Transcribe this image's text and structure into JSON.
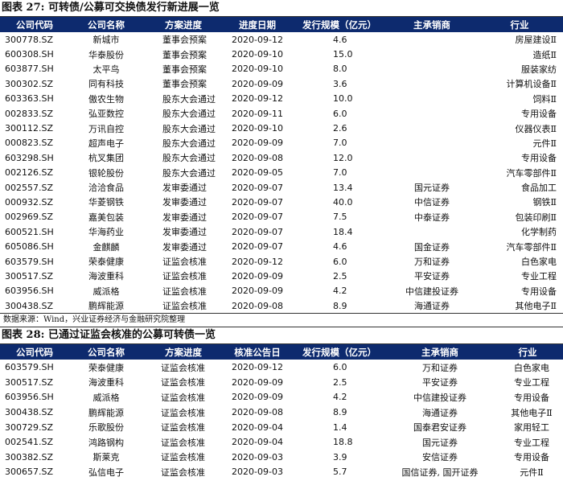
{
  "table1": {
    "title": "图表 27:  可转债/公募可交换债发行新进展一览",
    "headers": [
      "公司代码",
      "公司名称",
      "方案进度",
      "进度日期",
      "发行规模（亿元）",
      "主承销商",
      "行业"
    ],
    "rows": [
      [
        "300778.SZ",
        "新城市",
        "董事会预案",
        "2020-09-12",
        "4.6",
        "",
        "房屋建设Ⅱ"
      ],
      [
        "600308.SH",
        "华泰股份",
        "董事会预案",
        "2020-09-10",
        "15.0",
        "",
        "造纸Ⅱ"
      ],
      [
        "603877.SH",
        "太平鸟",
        "董事会预案",
        "2020-09-10",
        "8.0",
        "",
        "服装家纺"
      ],
      [
        "300302.SZ",
        "同有科技",
        "董事会预案",
        "2020-09-09",
        "3.6",
        "",
        "计算机设备Ⅱ"
      ],
      [
        "603363.SH",
        "傲农生物",
        "股东大会通过",
        "2020-09-12",
        "10.0",
        "",
        "饲料Ⅱ"
      ],
      [
        "002833.SZ",
        "弘亚数控",
        "股东大会通过",
        "2020-09-11",
        "6.0",
        "",
        "专用设备"
      ],
      [
        "300112.SZ",
        "万讯自控",
        "股东大会通过",
        "2020-09-10",
        "2.6",
        "",
        "仪器仪表Ⅱ"
      ],
      [
        "000823.SZ",
        "超声电子",
        "股东大会通过",
        "2020-09-09",
        "7.0",
        "",
        "元件Ⅱ"
      ],
      [
        "603298.SH",
        "杭叉集团",
        "股东大会通过",
        "2020-09-08",
        "12.0",
        "",
        "专用设备"
      ],
      [
        "002126.SZ",
        "银轮股份",
        "股东大会通过",
        "2020-09-05",
        "7.0",
        "",
        "汽车零部件Ⅱ"
      ],
      [
        "002557.SZ",
        "洽洽食品",
        "发审委通过",
        "2020-09-07",
        "13.4",
        "国元证券",
        "食品加工"
      ],
      [
        "000932.SZ",
        "华菱钢铁",
        "发审委通过",
        "2020-09-07",
        "40.0",
        "中信证券",
        "钢铁Ⅱ"
      ],
      [
        "002969.SZ",
        "嘉美包装",
        "发审委通过",
        "2020-09-07",
        "7.5",
        "中泰证券",
        "包装印刷Ⅱ"
      ],
      [
        "600521.SH",
        "华海药业",
        "发审委通过",
        "2020-09-07",
        "18.4",
        "",
        "化学制药"
      ],
      [
        "605086.SH",
        "金麒麟",
        "发审委通过",
        "2020-09-07",
        "4.6",
        "国金证券",
        "汽车零部件Ⅱ"
      ],
      [
        "603579.SH",
        "荣泰健康",
        "证监会核准",
        "2020-09-12",
        "6.0",
        "万和证券",
        "白色家电"
      ],
      [
        "300517.SZ",
        "海波重科",
        "证监会核准",
        "2020-09-09",
        "2.5",
        "平安证券",
        "专业工程"
      ],
      [
        "603956.SH",
        "威派格",
        "证监会核准",
        "2020-09-09",
        "4.2",
        "中信建投证券",
        "专用设备"
      ],
      [
        "300438.SZ",
        "鹏辉能源",
        "证监会核准",
        "2020-09-08",
        "8.9",
        "海通证券",
        "其他电子Ⅱ"
      ]
    ],
    "source": "数据来源：Wind，兴业证券经济与金融研究院整理"
  },
  "table2": {
    "title": "图表 28:  已通过证监会核准的公募可转债一览",
    "headers": [
      "公司代码",
      "公司名称",
      "方案进度",
      "核准公告日",
      "发行规模（亿元）",
      "主承销商",
      "行业"
    ],
    "rows": [
      [
        "603579.SH",
        "荣泰健康",
        "证监会核准",
        "2020-09-12",
        "6.0",
        "万和证券",
        "白色家电"
      ],
      [
        "300517.SZ",
        "海波重科",
        "证监会核准",
        "2020-09-09",
        "2.5",
        "平安证券",
        "专业工程"
      ],
      [
        "603956.SH",
        "威派格",
        "证监会核准",
        "2020-09-09",
        "4.2",
        "中信建投证券",
        "专用设备"
      ],
      [
        "300438.SZ",
        "鹏辉能源",
        "证监会核准",
        "2020-09-08",
        "8.9",
        "海通证券",
        "其他电子Ⅱ"
      ],
      [
        "300729.SZ",
        "乐歌股份",
        "证监会核准",
        "2020-09-04",
        "1.4",
        "国泰君安证券",
        "家用轻工"
      ],
      [
        "002541.SZ",
        "鸿路钢构",
        "证监会核准",
        "2020-09-04",
        "18.8",
        "国元证券",
        "专业工程"
      ],
      [
        "300382.SZ",
        "斯莱克",
        "证监会核准",
        "2020-09-03",
        "3.9",
        "安信证券",
        "专用设备"
      ],
      [
        "300657.SZ",
        "弘信电子",
        "证监会核准",
        "2020-09-03",
        "5.7",
        "国信证券, 国开证券",
        "元件Ⅱ"
      ]
    ]
  },
  "colors": {
    "header_bg": "#0d2a6e",
    "header_text": "#ffffff"
  }
}
